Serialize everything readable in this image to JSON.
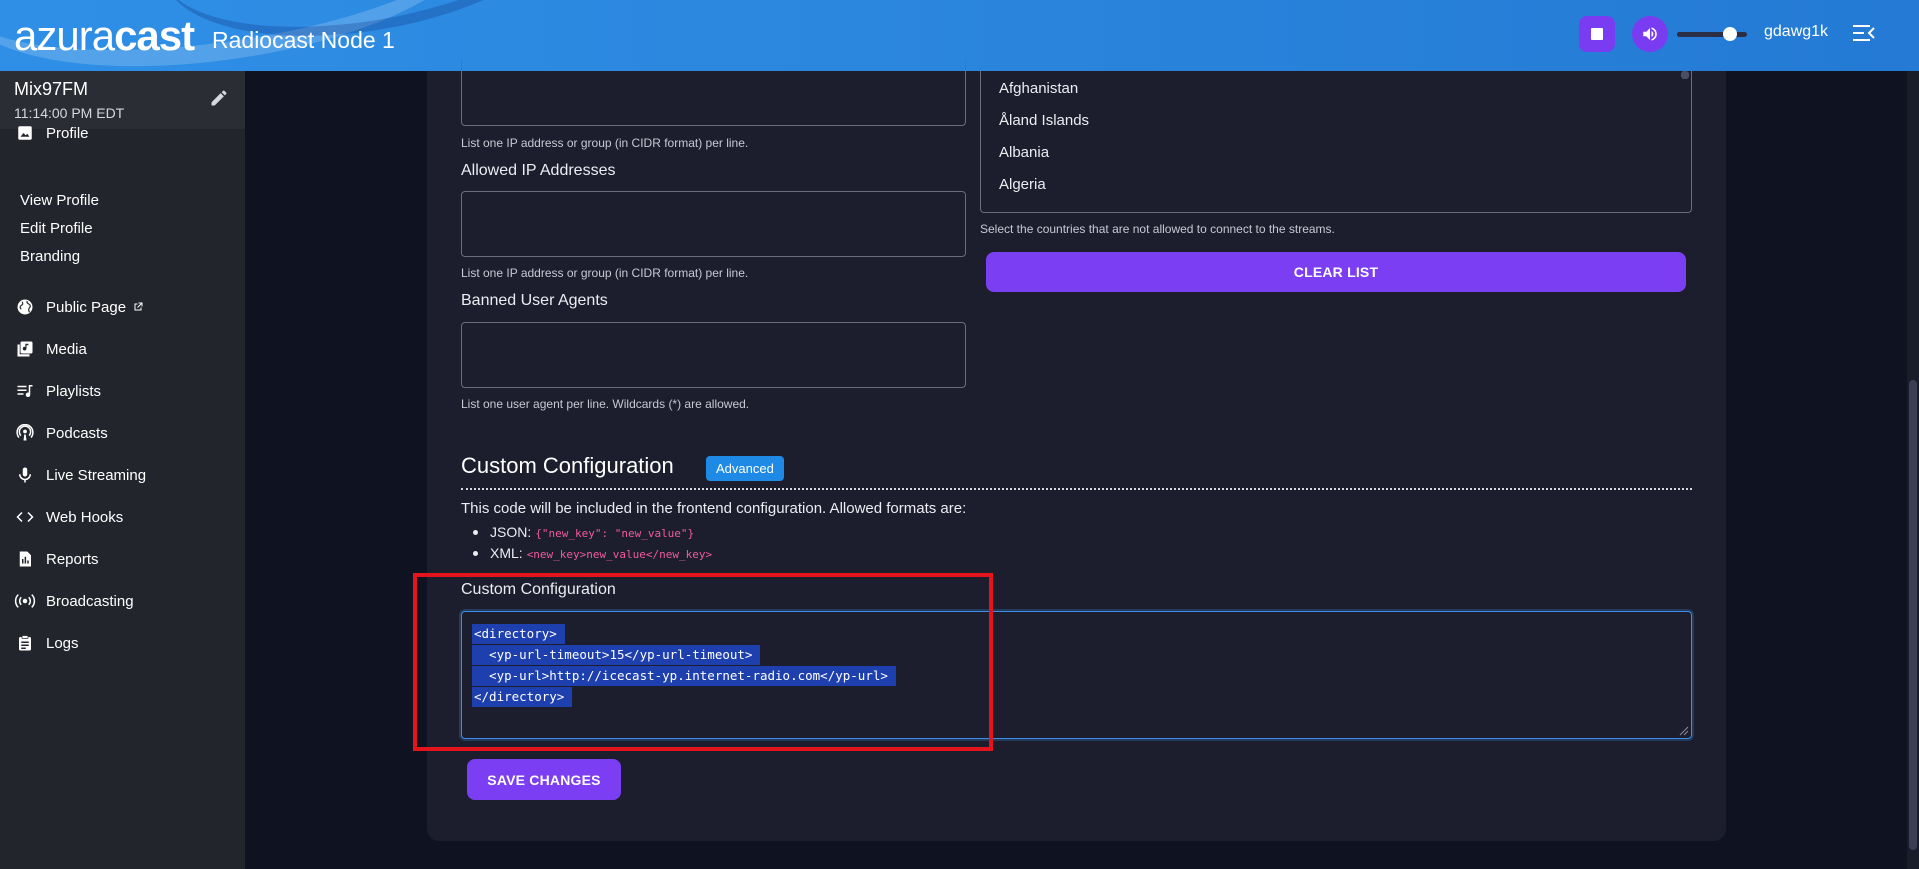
{
  "header": {
    "logo_light": "azura",
    "logo_bold": "cast",
    "node_name": "Radiocast Node 1",
    "username": "gdawg1k",
    "volume_level": 0.75
  },
  "sidebar": {
    "station_name": "Mix97FM",
    "station_time": "11:14:00 PM EDT",
    "profile_label": "Profile",
    "sub_items": [
      "View Profile",
      "Edit Profile",
      "Branding"
    ],
    "items": [
      {
        "label": "Public Page",
        "icon": "globe-icon"
      },
      {
        "label": "Media",
        "icon": "media-library-icon"
      },
      {
        "label": "Playlists",
        "icon": "playlist-icon"
      },
      {
        "label": "Podcasts",
        "icon": "podcast-icon"
      },
      {
        "label": "Live Streaming",
        "icon": "microphone-icon"
      },
      {
        "label": "Web Hooks",
        "icon": "code-brackets-icon"
      },
      {
        "label": "Reports",
        "icon": "report-icon"
      },
      {
        "label": "Broadcasting",
        "icon": "broadcast-icon"
      },
      {
        "label": "Logs",
        "icon": "clipboard-icon"
      }
    ]
  },
  "form": {
    "banned_ip_help": "List one IP address or group (in CIDR format) per line.",
    "allowed_ip_label": "Allowed IP Addresses",
    "allowed_ip_help": "List one IP address or group (in CIDR format) per line.",
    "banned_ua_label": "Banned User Agents",
    "banned_ua_help": "List one user agent per line. Wildcards (*) are allowed.",
    "countries": [
      "Afghanistan",
      "Åland Islands",
      "Albania",
      "Algeria"
    ],
    "countries_help": "Select the countries that are not allowed to connect to the streams.",
    "clear_list_label": "CLEAR LIST"
  },
  "custom_config": {
    "title": "Custom Configuration",
    "badge": "Advanced",
    "description": "This code will be included in the frontend configuration. Allowed formats are:",
    "json_label": "JSON:",
    "json_example": "{\"new_key\": \"new_value\"}",
    "xml_label": "XML:",
    "xml_example": "<new_key>new_value</new_key>",
    "field_label": "Custom Configuration",
    "code_lines": [
      "<directory>",
      "  <yp-url-timeout>15</yp-url-timeout>",
      "  <yp-url>http://icecast-yp.internet-radio.com</yp-url>",
      "</directory>"
    ],
    "save_label": "SAVE CHANGES"
  },
  "colors": {
    "accent": "#7b3ef2",
    "header": "#2b86dd",
    "badge": "#1f8ae6",
    "highlight": "#e3141b"
  }
}
